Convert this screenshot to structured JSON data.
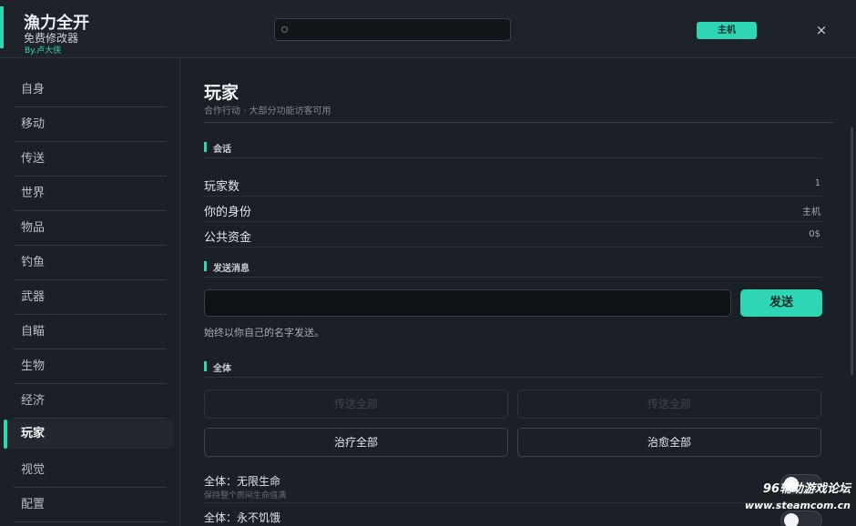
{
  "header": {
    "title": "漁力全开",
    "subtitle": "免费修改器",
    "author": "By.卢大侠",
    "search_placeholder": "",
    "role_button": "主机",
    "close_glyph": "×"
  },
  "sidebar": {
    "items": [
      {
        "label": "自身"
      },
      {
        "label": "移动"
      },
      {
        "label": "传送"
      },
      {
        "label": "世界"
      },
      {
        "label": "物品"
      },
      {
        "label": "钓鱼"
      },
      {
        "label": "武器"
      },
      {
        "label": "自瞄"
      },
      {
        "label": "生物"
      },
      {
        "label": "经济"
      },
      {
        "label": "玩家"
      },
      {
        "label": "视觉"
      },
      {
        "label": "配置"
      }
    ],
    "active_index": 10
  },
  "main": {
    "title": "玩家",
    "subtitle": "合作行动 · 大部分功能访客可用",
    "session": {
      "heading": "会话",
      "rows": [
        {
          "key": "玩家数",
          "value": "1"
        },
        {
          "key": "你的身份",
          "value": "主机"
        },
        {
          "key": "公共资金",
          "value": "0$"
        }
      ]
    },
    "message": {
      "heading": "发送消息",
      "input_value": "",
      "send_label": "发送",
      "hint": "始终以你自己的名字发送。"
    },
    "all": {
      "heading": "全体",
      "disabled_buttons": [
        "传送全部",
        "传送全部"
      ],
      "buttons": [
        "治疗全部",
        "治愈全部"
      ],
      "toggles": [
        {
          "title": "全体：无限生命",
          "desc": "保持整个房间生命值满",
          "on": false
        },
        {
          "title": "全体：永不饥饿",
          "desc": "",
          "on": false
        }
      ]
    }
  },
  "watermark": {
    "line1": "96辅助游戏论坛",
    "line2": "www.steamcom.cn"
  },
  "colors": {
    "accent": "#2fd6b6",
    "background": "#1b1f26"
  }
}
